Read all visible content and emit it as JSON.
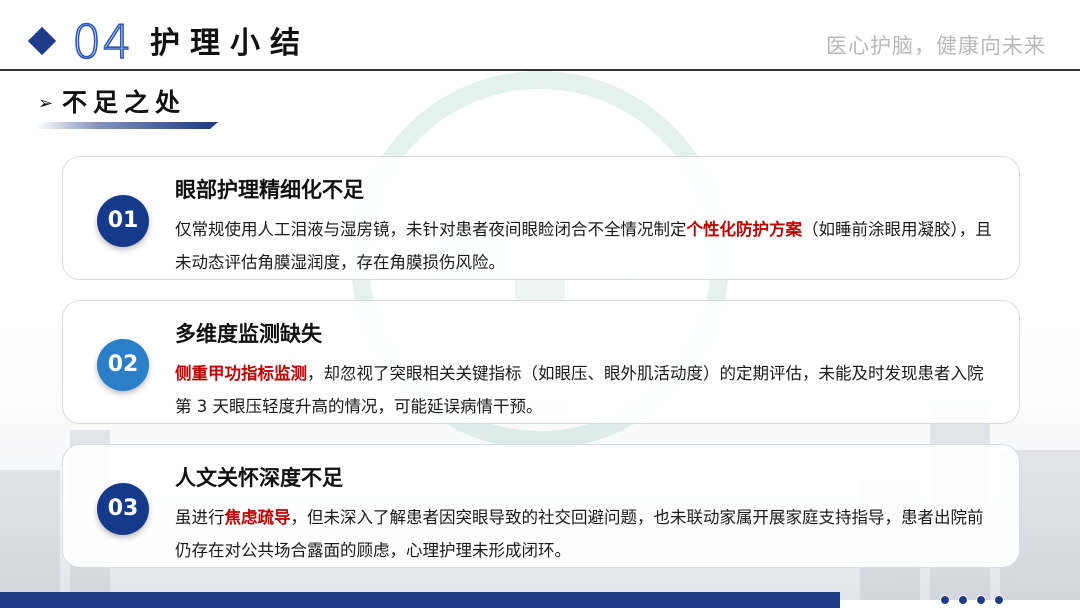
{
  "header": {
    "section_number": "04",
    "section_title": "护理小结",
    "slogan": "医心护脑，健康向未来"
  },
  "subtitle": {
    "arrow": "➢",
    "text": "不足之处"
  },
  "cards": [
    {
      "number": "01",
      "badge_color": "#163a8a",
      "title": "眼部护理精细化不足",
      "body_pre": "仅常规使用人工泪液与湿房镜，未针对患者夜间眼睑闭合不全情况制定",
      "body_highlight": "个性化防护方案",
      "body_post": "（如睡前涂眼用凝胶），且未动态评估角膜湿润度，存在角膜损伤风险。"
    },
    {
      "number": "02",
      "badge_color": "#2a7fc8",
      "title": "多维度监测缺失",
      "body_pre": "",
      "body_highlight": "侧重甲功指标监测",
      "body_post": "，却忽视了突眼相关关键指标（如眼压、眼外肌活动度）的定期评估，未能及时发现患者入院第 3 天眼压轻度升高的情况，可能延误病情干预。"
    },
    {
      "number": "03",
      "badge_color": "#163a8a",
      "title": "人文关怀深度不足",
      "body_pre": "虽进行",
      "body_highlight": "焦虑疏导",
      "body_post": "，但未深入了解患者因突眼导致的社交回避问题，也未联动家属开展家庭支持指导，患者出院前仍存在对公共场合露面的顾虑，心理护理未形成闭环。"
    }
  ],
  "colors": {
    "primary": "#1f3c88",
    "highlight": "#c00000"
  }
}
